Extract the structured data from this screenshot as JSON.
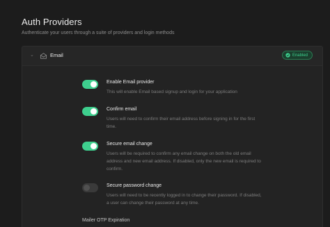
{
  "page": {
    "title": "Auth Providers",
    "subtitle": "Authenticate your users through a suite of providers and login methods"
  },
  "provider": {
    "name": "Email",
    "icon": "mail-icon",
    "status": "Enabled",
    "status_color": "#3ecf8e",
    "expanded": true
  },
  "settings": [
    {
      "label": "Enable Email provider",
      "description": "This will enable Email based signup and login for your application",
      "enabled": true
    },
    {
      "label": "Confirm email",
      "description": "Users will need to confirm their email address before signing in for the first time.",
      "enabled": true
    },
    {
      "label": "Secure email change",
      "description": "Users will be required to confirm any email change on both the old email address and new email address. If disabled, only the new email is required to confirm.",
      "enabled": true
    },
    {
      "label": "Secure password change",
      "description": "Users will need to be recently logged in to change their password. If disabled, a user can change their password at any time.",
      "enabled": false
    }
  ],
  "mailer_otp": {
    "label": "Mailer OTP Expiration"
  },
  "colors": {
    "background": "#1c1c1c",
    "panel": "#232323",
    "accent": "#3ecf8e"
  }
}
